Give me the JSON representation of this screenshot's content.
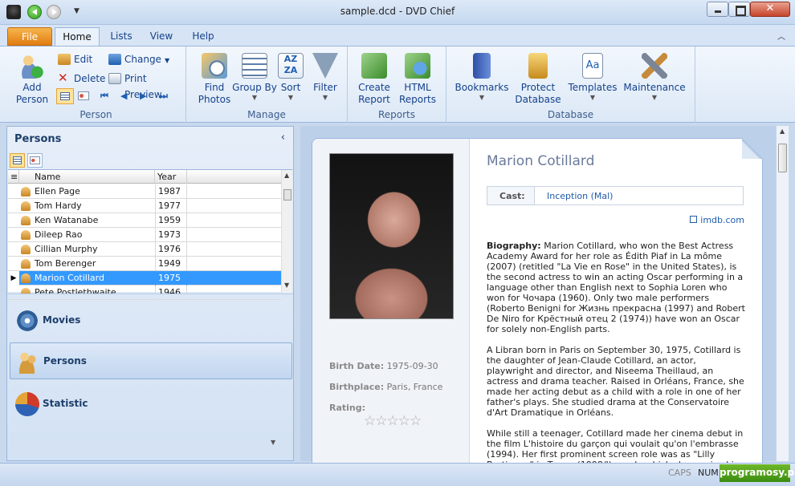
{
  "window": {
    "title": "sample.dcd - DVD Chief",
    "close_label": "✕"
  },
  "ribbon": {
    "tabs": [
      "File",
      "Home",
      "Lists",
      "View",
      "Help"
    ],
    "groups": {
      "person": {
        "label": "Person",
        "add": "Add Person",
        "edit": "Edit",
        "delete": "Delete",
        "change": "Change",
        "print_preview": "Print Preview"
      },
      "manage": {
        "label": "Manage",
        "find_photos": "Find Photos",
        "group_by": "Group By",
        "sort": "Sort",
        "filter": "Filter"
      },
      "reports": {
        "label": "Reports",
        "create_report": "Create Report",
        "html_reports": "HTML Reports"
      },
      "database": {
        "label": "Database",
        "bookmarks": "Bookmarks",
        "protect_database": "Protect Database",
        "templates": "Templates",
        "maintenance": "Maintenance"
      }
    }
  },
  "left_pane": {
    "title": "Persons",
    "grid": {
      "headers": {
        "name": "Name",
        "year": "Year"
      },
      "rows": [
        {
          "name": "Ellen Page",
          "year": "1987"
        },
        {
          "name": "Tom Hardy",
          "year": "1977"
        },
        {
          "name": "Ken Watanabe",
          "year": "1959"
        },
        {
          "name": "Dileep Rao",
          "year": "1973"
        },
        {
          "name": "Cillian Murphy",
          "year": "1976"
        },
        {
          "name": "Tom Berenger",
          "year": "1949"
        },
        {
          "name": "Marion Cotillard",
          "year": "1975"
        },
        {
          "name": "Pete Postlethwaite",
          "year": "1946"
        }
      ],
      "selected_index": 6
    },
    "nav": {
      "movies": "Movies",
      "persons": "Persons",
      "statistic": "Statistic"
    }
  },
  "detail": {
    "name": "Marion Cotillard",
    "cast_label": "Cast:",
    "cast_value": "Inception (Mal)",
    "imdb": "imdb.com",
    "birth_date_label": "Birth Date:",
    "birth_date": "1975-09-30",
    "birthplace_label": "Birthplace:",
    "birthplace": "Paris, France",
    "rating_label": "Rating:",
    "rating": 0,
    "rating_stars": "☆☆☆☆☆",
    "bio_label": "Biography:",
    "bio_p1": "Marion Cotillard, who won the Best Actress Academy Award for her role as Édith Piaf in La môme (2007) (retitled \"La Vie en Rose\" in the United States), is the second actress to win an acting Oscar performing in a language other than English next to Sophia Loren who won for Чочара (1960). Only two male performers (Roberto Benigni for Жизнь прекрасна (1997) and Robert De Niro for Крёстный отец 2 (1974)) have won an Oscar for solely non-English parts.",
    "bio_p2": "A Libran born in Paris on September 30, 1975, Cotillard is the daughter of Jean-Claude Cotillard, an actor, playwright and director, and Niseema Theillaud, an actress and drama teacher. Raised in Orléans, France, she made her acting debut as a child with a role in one of her father's plays. She studied drama at the Conservatoire d'Art Dramatique in Orléans.",
    "bio_p3": "While still a teenager, Cotillard made her cinema debut in the film L'histoire du garçon qui voulait qu'on l'embrasse (1994). Her first prominent screen role was as \"Lilly Bertineau\" in Такси (1998/I), a role which she reprised in two sequels. Director Olivier Dahan cast Cotillard to play Édith Piaf, the legendary French singer, in La"
  },
  "status": {
    "caps": "CAPS",
    "num": "NUM",
    "brand": "programosy.pl"
  }
}
